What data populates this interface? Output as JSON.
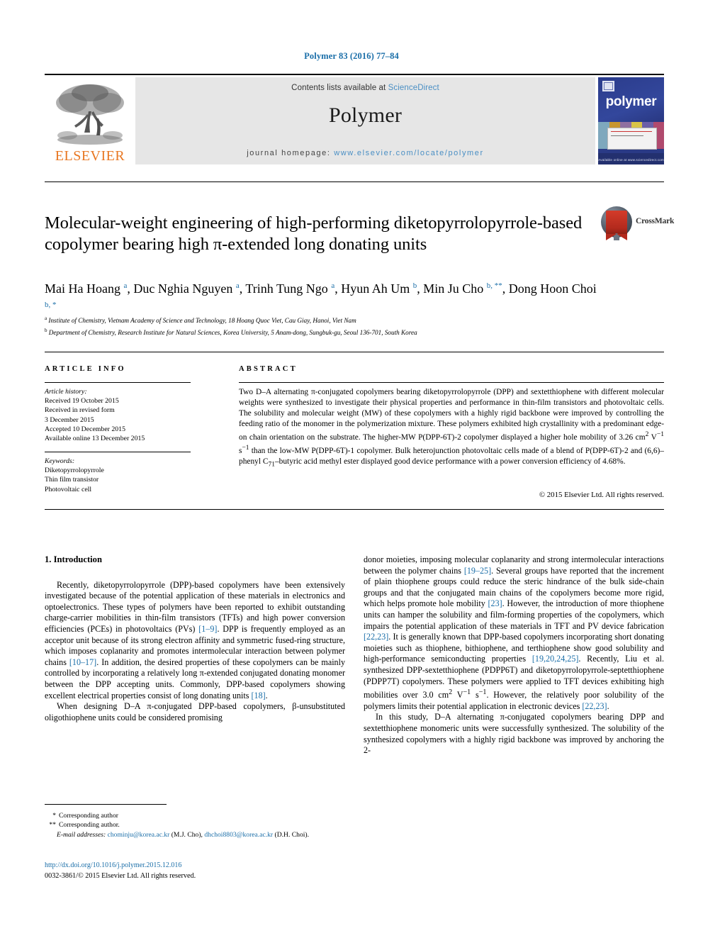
{
  "running_head": "Polymer 83 (2016) 77–84",
  "masthead": {
    "publisher_name": "ELSEVIER",
    "contents_prefix": "Contents lists available at ",
    "contents_link": "ScienceDirect",
    "journal_title": "Polymer",
    "homepage_prefix": "journal homepage: ",
    "homepage_url": "www.elsevier.com/locate/polymer",
    "cover_word": "polymer",
    "cover_footer": "Available online at www.sciencedirect.com"
  },
  "crossmark": {
    "label": "CrossMark"
  },
  "title": "Molecular-weight engineering of high-performing diketopyrrolopyrrole-based copolymer bearing high π-extended long donating units",
  "authors_html": "Mai Ha Hoang <sup>a</sup>, Duc Nghia Nguyen <sup>a</sup>, Trinh Tung Ngo <sup>a</sup>, Hyun Ah Um <sup>b</sup>, Min Ju Cho <sup>b, **</sup>, Dong Hoon Choi <sup>b, *</sup>",
  "affiliations": [
    "Institute of Chemistry, Vietnam Academy of Science and Technology, 18 Hoang Quoc Viet, Cau Giay, Hanoi, Viet Nam",
    "Department of Chemistry, Research Institute for Natural Sciences, Korea University, 5 Anam-dong, Sungbuk-gu, Seoul 136-701, South Korea"
  ],
  "affiliation_marks": [
    "a",
    "b"
  ],
  "article_info": {
    "heading": "ARTICLE INFO",
    "history_label": "Article history:",
    "history_lines": [
      "Received 19 October 2015",
      "Received in revised form",
      "3 December 2015",
      "Accepted 10 December 2015",
      "Available online 13 December 2015"
    ],
    "keywords_label": "Keywords:",
    "keywords": [
      "Diketopyrrolopyrrole",
      "Thin film transistor",
      "Photovoltaic cell"
    ]
  },
  "abstract": {
    "heading": "ABSTRACT",
    "text": "Two D–A alternating π-conjugated copolymers bearing diketopyrrolopyrrole (DPP) and sextetthiophene with different molecular weights were synthesized to investigate their physical properties and performance in thin-film transistors and photovoltaic cells. The solubility and molecular weight (MW) of these copolymers with a highly rigid backbone were improved by controlling the feeding ratio of the monomer in the polymerization mixture. These polymers exhibited high crystallinity with a predominant edge-on chain orientation on the substrate. The higher-MW P(DPP-6T)-2 copolymer displayed a higher hole mobility of 3.26 cm2 V−1 s−1 than the low-MW P(DPP-6T)-1 copolymer. Bulk heterojunction photovoltaic cells made of a blend of P(DPP-6T)-2 and (6,6)–phenyl C71–butyric acid methyl ester displayed good device performance with a power conversion efficiency of 4.68%.",
    "copyright": "© 2015 Elsevier Ltd. All rights reserved."
  },
  "body": {
    "section_heading": "1. Introduction",
    "left_paragraphs": [
      "Recently, diketopyrrolopyrrole (DPP)-based copolymers have been extensively investigated because of the potential application of these materials in electronics and optoelectronics. These types of polymers have been reported to exhibit outstanding charge-carrier mobilities in thin-film transistors (TFTs) and high power conversion efficiencies (PCEs) in photovoltaics (PVs) [1–9]. DPP is frequently employed as an acceptor unit because of its strong electron affinity and symmetric fused-ring structure, which imposes coplanarity and promotes intermolecular interaction between polymer chains [10–17]. In addition, the desired properties of these copolymers can be mainly controlled by incorporating a relatively long π-extended conjugated donating monomer between the DPP accepting units. Commonly, DPP-based copolymers showing excellent electrical properties consist of long donating units [18].",
      "When designing D–A π-conjugated DPP-based copolymers, β-unsubstituted oligothiophene units could be considered promising"
    ],
    "right_paragraphs": [
      "donor moieties, imposing molecular coplanarity and strong intermolecular interactions between the polymer chains [19–25]. Several groups have reported that the increment of plain thiophene groups could reduce the steric hindrance of the bulk side-chain groups and that the conjugated main chains of the copolymers become more rigid, which helps promote hole mobility [23]. However, the introduction of more thiophene units can hamper the solubility and film-forming properties of the copolymers, which impairs the potential application of these materials in TFT and PV device fabrication [22,23]. It is generally known that DPP-based copolymers incorporating short donating moieties such as thiophene, bithiophene, and terthiophene show good solubility and high-performance semiconducting properties [19,20,24,25]. Recently, Liu et al. synthesized DPP-sextetthiophene (PDPP6T) and diketopyrrolopyrrole-septetthiophene (PDPP7T) copolymers. These polymers were applied to TFT devices exhibiting high mobilities over 3.0 cm2 V−1 s−1. However, the relatively poor solubility of the polymers limits their potential application in electronic devices [22,23].",
      "In this study, D–A alternating π-conjugated copolymers bearing DPP and sextetthiophene monomeric units were successfully synthesized. The solubility of the synthesized copolymers with a highly rigid backbone was improved by anchoring the 2-"
    ]
  },
  "footnotes": {
    "single_star": "*",
    "double_star": "**",
    "corresponding_author_1": "Corresponding author",
    "corresponding_author_2": "Corresponding author.",
    "email_label": "E-mail addresses:",
    "email_1": "chominju@korea.ac.kr",
    "email_1_owner": "(M.J. Cho),",
    "email_2": "dhchoi8803@korea.ac.kr",
    "email_2_owner": "(D.H. Choi)."
  },
  "doi": "http://dx.doi.org/10.1016/j.polymer.2015.12.016",
  "issn_line": "0032-3861/© 2015 Elsevier Ltd. All rights reserved.",
  "colors": {
    "link_blue": "#1a6ea8",
    "elsevier_orange": "#e87722",
    "banner_grey": "#e6e6e6",
    "cover_navy": "#2a3a86"
  }
}
